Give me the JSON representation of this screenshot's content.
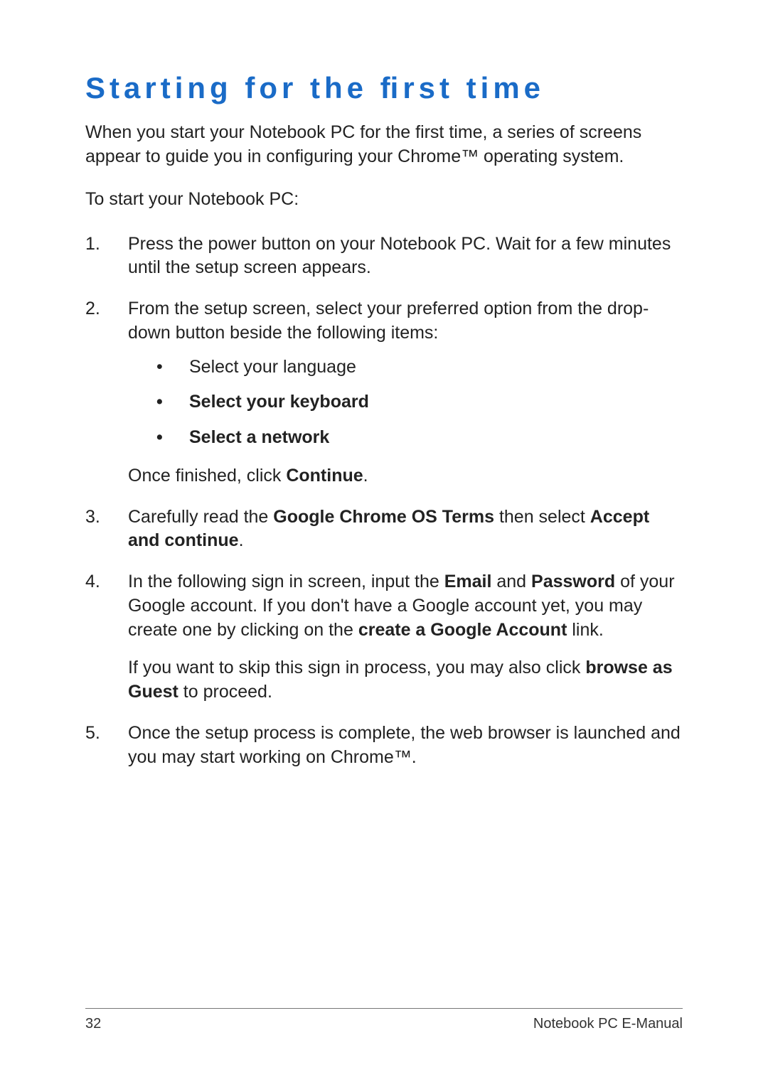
{
  "title": "Starting for the ﬁrst time",
  "intro": "When you start your Notebook PC for the ﬁrst time, a series of screens appear to guide you in conﬁguring your Chrome™ operating system.",
  "lead": "To start your Notebook PC:",
  "steps": {
    "s1": "Press the power button on your Notebook PC. Wait for a few minutes until the setup screen appears.",
    "s2": "From the setup screen, select your preferred option from the drop-down button beside the following items:",
    "s2_b1": "Select your language",
    "s2_b2": "Select your keyboard",
    "s2_b3": "Select a network",
    "s2_after_a": "Once ﬁnished, click ",
    "s2_after_b": "Continue",
    "s2_after_c": ".",
    "s3_a": "Carefully read the ",
    "s3_b": "Google Chrome OS Terms ",
    "s3_c": "then select ",
    "s3_d": "Accept and continue",
    "s3_e": ".",
    "s4_a": "In the following sign in screen, input the ",
    "s4_b": "Email",
    "s4_c": " and ",
    "s4_d": "Password ",
    "s4_e": "of your Google account. If you don't have a Google account yet, you may create one by clicking on the ",
    "s4_f": "create a Google Account",
    "s4_g": " link.",
    "s4_p2_a": "If you want to skip this sign in process, you may also click ",
    "s4_p2_b": "browse as Guest",
    "s4_p2_c": " to proceed.",
    "s5": "Once the setup process is complete, the web browser is launched and you may start working on Chrome™."
  },
  "footer": {
    "page": "32",
    "doc": "Notebook PC E-Manual"
  }
}
